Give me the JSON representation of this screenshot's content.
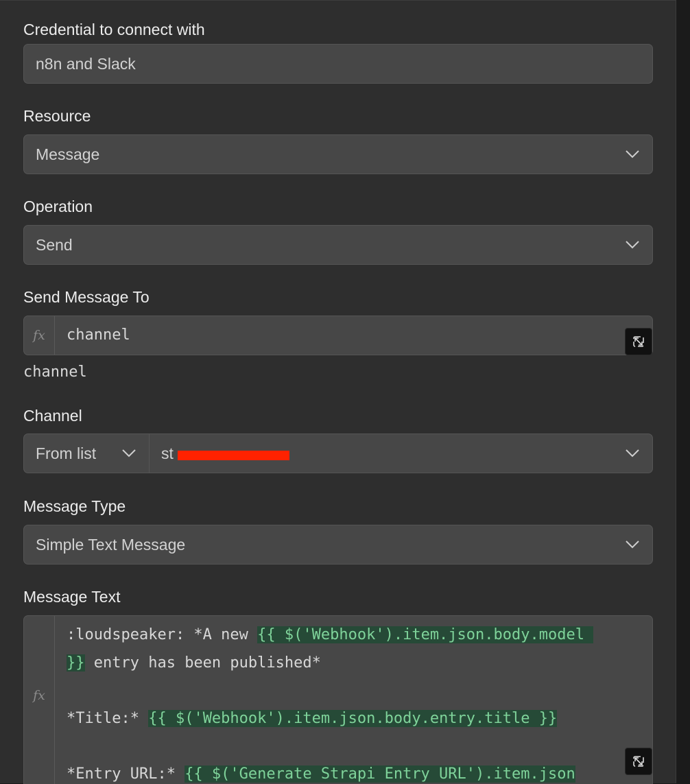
{
  "credential": {
    "label": "Credential to connect with",
    "value": "n8n and Slack"
  },
  "resource": {
    "label": "Resource",
    "value": "Message"
  },
  "operation": {
    "label": "Operation",
    "value": "Send"
  },
  "send_to": {
    "label": "Send Message To",
    "fx": "fx",
    "value": "channel",
    "hint": "channel"
  },
  "channel": {
    "label": "Channel",
    "mode": "From list",
    "value": "st"
  },
  "message_type": {
    "label": "Message Type",
    "value": "Simple Text Message"
  },
  "message_text": {
    "label": "Message Text",
    "fx": "fx",
    "lines": [
      [
        {
          "t": ":loudspeaker: *A new "
        },
        {
          "e": "{{ $('Webhook').item.json.body.model "
        }
      ],
      [
        {
          "e": "}}"
        },
        {
          "t": " entry has been published*"
        }
      ],
      [],
      [
        {
          "t": "*Title:* "
        },
        {
          "e": "{{ $('Webhook').item.json.body.entry.title }}"
        }
      ],
      [],
      [
        {
          "t": "*Entry URL:* "
        },
        {
          "e": "{{ $('Generate Strapi Entry URL').item.json"
        }
      ]
    ]
  },
  "colors": {
    "expression_bg": "#264a37",
    "expression_text": "#7fd39a",
    "redaction": "#ff2200"
  }
}
